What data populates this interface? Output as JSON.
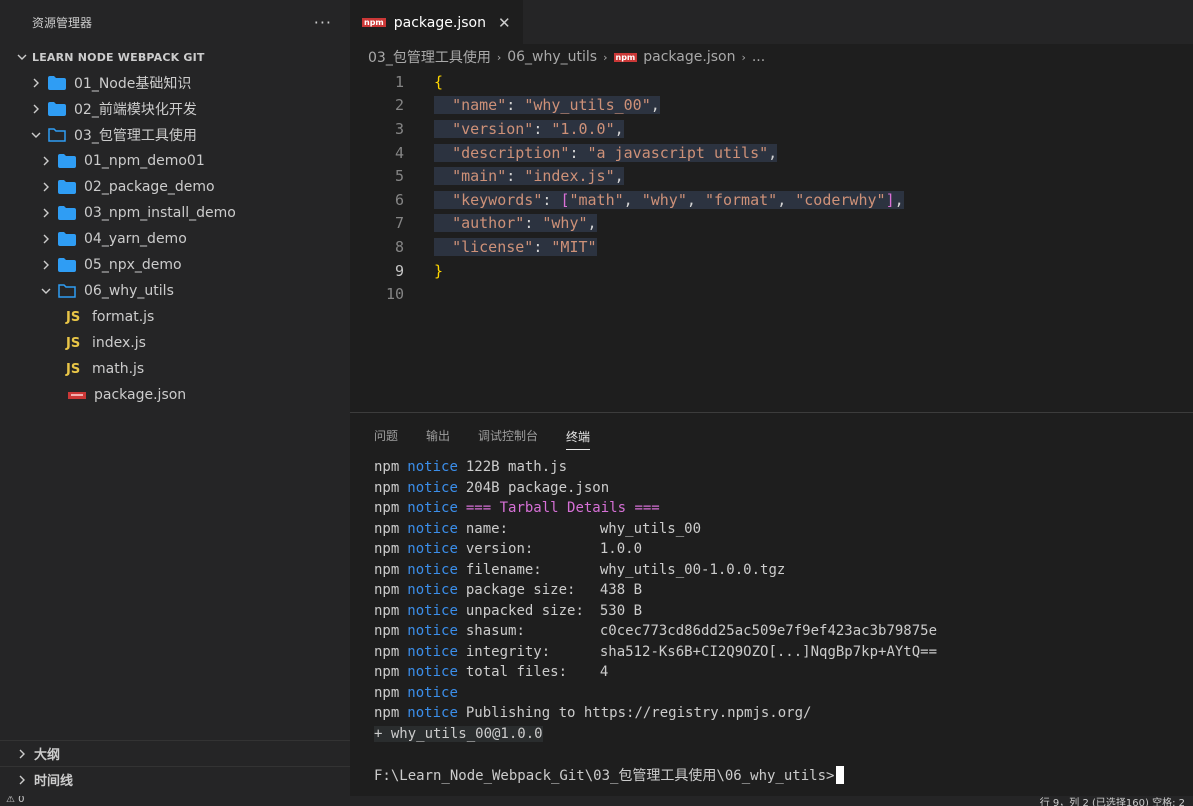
{
  "sidebar": {
    "title": "资源管理器",
    "more": "···",
    "project": "LEARN NODE WEBPACK GIT",
    "tree": [
      {
        "label": "01_Node基础知识",
        "type": "folder",
        "expanded": false,
        "depth": 0
      },
      {
        "label": "02_前端模块化开发",
        "type": "folder",
        "expanded": false,
        "depth": 0
      },
      {
        "label": "03_包管理工具使用",
        "type": "folder",
        "expanded": true,
        "depth": 0
      },
      {
        "label": "01_npm_demo01",
        "type": "folder",
        "expanded": false,
        "depth": 1
      },
      {
        "label": "02_package_demo",
        "type": "folder",
        "expanded": false,
        "depth": 1
      },
      {
        "label": "03_npm_install_demo",
        "type": "folder",
        "expanded": false,
        "depth": 1
      },
      {
        "label": "04_yarn_demo",
        "type": "folder",
        "expanded": false,
        "depth": 1
      },
      {
        "label": "05_npx_demo",
        "type": "folder",
        "expanded": false,
        "depth": 1
      },
      {
        "label": "06_why_utils",
        "type": "folder",
        "expanded": true,
        "depth": 1
      },
      {
        "label": "format.js",
        "type": "js",
        "depth": 2
      },
      {
        "label": "index.js",
        "type": "js",
        "depth": 2
      },
      {
        "label": "math.js",
        "type": "js",
        "depth": 2
      },
      {
        "label": "package.json",
        "type": "npm",
        "depth": 2
      }
    ],
    "outline": "大纲",
    "timeline": "时间线"
  },
  "editor": {
    "tab_label": "package.json",
    "tab_badge": "npm",
    "breadcrumb": [
      "03_包管理工具使用",
      "06_why_utils",
      "package.json",
      "..."
    ],
    "lines": [
      "1",
      "2",
      "3",
      "4",
      "5",
      "6",
      "7",
      "8",
      "9",
      "10"
    ]
  },
  "panel": {
    "tabs": [
      "问题",
      "输出",
      "调试控制台",
      "终端"
    ],
    "terminal": {
      "prefix": "npm",
      "notice": "notice",
      "line1": "122B math.js",
      "line2": "204B package.json",
      "tarball": "=== Tarball Details ===",
      "details": [
        {
          "label": "name:",
          "value": "why_utils_00"
        },
        {
          "label": "version:",
          "value": "1.0.0"
        },
        {
          "label": "filename:",
          "value": "why_utils_00-1.0.0.tgz"
        },
        {
          "label": "package size:",
          "value": "438 B"
        },
        {
          "label": "unpacked size:",
          "value": "530 B"
        },
        {
          "label": "shasum:",
          "value": "c0cec773cd86dd25ac509e7f9ef423ac3b79875e"
        },
        {
          "label": "integrity:",
          "value": "sha512-Ks6B+CI2Q9OZO[...]NqgBp7kp+AYtQ=="
        },
        {
          "label": "total files:",
          "value": "4"
        }
      ],
      "publishing": "Publishing to https://registry.npmjs.org/",
      "published": "+ why_utils_00@1.0.0",
      "prompt": "F:\\Learn_Node_Webpack_Git\\03_包管理工具使用\\06_why_utils>"
    }
  },
  "statusbar": {
    "left": "⚠ 0",
    "right": "行 9，列 2 (已选择160)   空格: 2"
  }
}
